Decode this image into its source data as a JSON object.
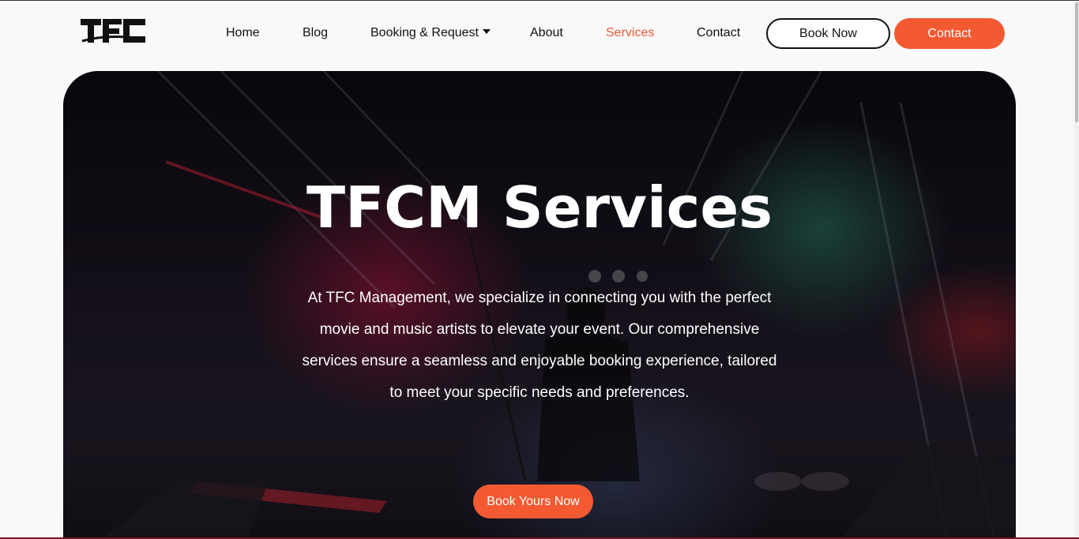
{
  "header": {
    "logo_text": "TFC",
    "nav": [
      {
        "label": "Home"
      },
      {
        "label": "Blog"
      },
      {
        "label": "Booking & Request"
      },
      {
        "label": "About"
      },
      {
        "label": "Services"
      },
      {
        "label": "Contact"
      }
    ],
    "active_nav": "Services",
    "book_now_label": "Book Now",
    "contact_label": "Contact"
  },
  "hero": {
    "title": "TFCM Services",
    "text": "At TFC Management, we specialize in connecting you with the perfect movie and music artists to elevate your event. Our comprehensive services ensure a seamless and enjoyable booking experience, tailored to meet your specific needs and preferences.",
    "cta_label": "Book Yours Now"
  },
  "colors": {
    "accent": "#f45a32",
    "active_nav": "#f05a36",
    "text": "#111111"
  }
}
